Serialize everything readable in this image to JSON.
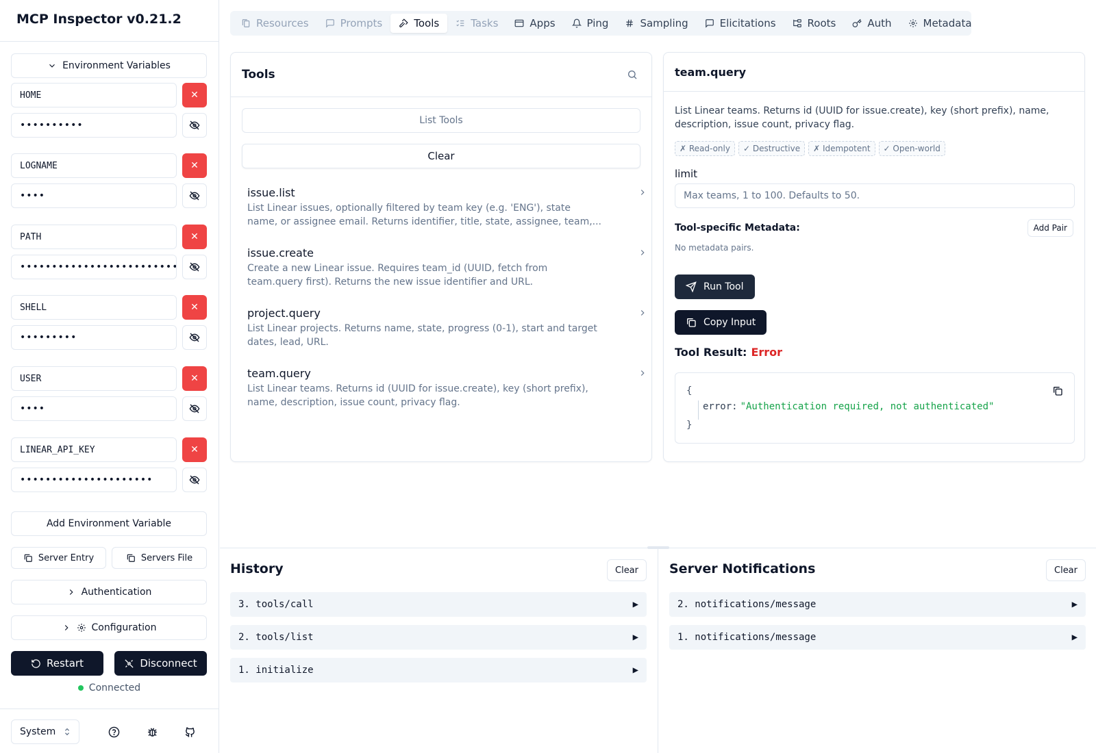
{
  "app": {
    "title": "MCP Inspector v0.21.2"
  },
  "sidebar": {
    "env_toggle": "Environment Variables",
    "env_vars": [
      {
        "key": "HOME",
        "masked": "••••••••••"
      },
      {
        "key": "LOGNAME",
        "masked": "••••"
      },
      {
        "key": "PATH",
        "masked": "••••••••••••••••••••••••••••"
      },
      {
        "key": "SHELL",
        "masked": "•••••••••"
      },
      {
        "key": "USER",
        "masked": "••••"
      },
      {
        "key": "LINEAR_API_KEY",
        "masked": "•••••••••••••••••••••"
      }
    ],
    "add_env": "Add Environment Variable",
    "server_entry": "Server Entry",
    "servers_file": "Servers File",
    "authentication": "Authentication",
    "configuration": "Configuration",
    "restart": "Restart",
    "disconnect": "Disconnect",
    "status": "Connected",
    "theme": "System",
    "status_color": "#22c55e"
  },
  "tabs": [
    {
      "label": "Resources",
      "icon": "files-icon",
      "state": "disabled"
    },
    {
      "label": "Prompts",
      "icon": "message-icon",
      "state": "disabled"
    },
    {
      "label": "Tools",
      "icon": "hammer-icon",
      "state": "active"
    },
    {
      "label": "Tasks",
      "icon": "list-checks-icon",
      "state": "disabled"
    },
    {
      "label": "Apps",
      "icon": "app-window-icon",
      "state": "normal"
    },
    {
      "label": "Ping",
      "icon": "bell-icon",
      "state": "normal"
    },
    {
      "label": "Sampling",
      "icon": "hash-icon",
      "state": "normal"
    },
    {
      "label": "Elicitations",
      "icon": "message-square-icon",
      "state": "normal"
    },
    {
      "label": "Roots",
      "icon": "folder-tree-icon",
      "state": "normal"
    },
    {
      "label": "Auth",
      "icon": "key-icon",
      "state": "normal"
    },
    {
      "label": "Metadata",
      "icon": "settings-icon",
      "state": "normal"
    }
  ],
  "tools_panel": {
    "title": "Tools",
    "list_tools": "List Tools",
    "clear": "Clear",
    "items": [
      {
        "name": "issue.list",
        "desc1": "List Linear issues, optionally filtered by team key (e.g. 'ENG'), state",
        "desc2": "name, or assignee email. Returns identifier, title, state, assignee, team,..."
      },
      {
        "name": "issue.create",
        "desc1": "Create a new Linear issue. Requires team_id (UUID, fetch from",
        "desc2": "team.query first). Returns the new issue identifier and URL."
      },
      {
        "name": "project.query",
        "desc1": "List Linear projects. Returns name, state, progress (0-1), start and target",
        "desc2": "dates, lead, URL."
      },
      {
        "name": "team.query",
        "desc1": "List Linear teams. Returns id (UUID for issue.create), key (short prefix),",
        "desc2": "name, description, issue count, privacy flag."
      }
    ]
  },
  "detail": {
    "title": "team.query",
    "desc1": "List Linear teams. Returns id (UUID for issue.create), key (short prefix), name,",
    "desc2": "description, issue count, privacy flag.",
    "badges": [
      "✗ Read-only",
      "✓ Destructive",
      "✗ Idempotent",
      "✓ Open-world"
    ],
    "param_label": "limit",
    "param_placeholder": "Max teams, 1 to 100. Defaults to 50.",
    "metadata_label": "Tool-specific Metadata:",
    "add_pair": "Add Pair",
    "no_metadata": "No metadata pairs.",
    "run": "Run Tool",
    "copy": "Copy Input",
    "result_label": "Tool Result:",
    "result_status": "Error",
    "result_open": "{",
    "result_key": "error:",
    "result_value": "\"Authentication required, not authenticated\"",
    "result_close": "}"
  },
  "history": {
    "title": "History",
    "clear": "Clear",
    "items": [
      "3. tools/call",
      "2. tools/list",
      "1. initialize"
    ]
  },
  "notifications": {
    "title": "Server Notifications",
    "clear": "Clear",
    "items": [
      "2. notifications/message",
      "1. notifications/message"
    ]
  },
  "colors": {
    "danger": "#ef4444",
    "dark": "#0f172a",
    "error_text": "#dc2626",
    "json_string": "#16a34a"
  }
}
